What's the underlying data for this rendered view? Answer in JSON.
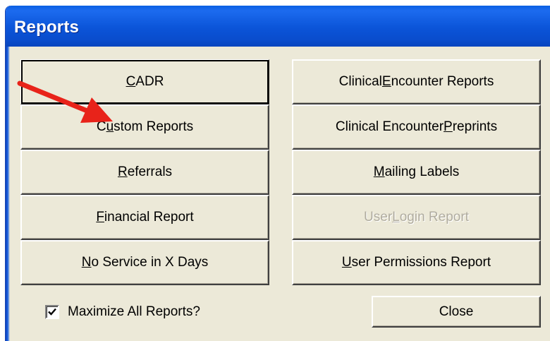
{
  "window": {
    "title": "Reports"
  },
  "buttons_left": [
    {
      "pre": "",
      "mn": "C",
      "post": "ADR",
      "enabled": true
    },
    {
      "pre": "C",
      "mn": "u",
      "post": "stom Reports",
      "enabled": true
    },
    {
      "pre": "",
      "mn": "R",
      "post": "eferrals",
      "enabled": true
    },
    {
      "pre": "",
      "mn": "F",
      "post": "inancial Report",
      "enabled": true
    },
    {
      "pre": "",
      "mn": "N",
      "post": "o Service in X Days",
      "enabled": true
    }
  ],
  "buttons_right": [
    {
      "pre": "Clinical ",
      "mn": "E",
      "post": "ncounter Reports",
      "enabled": true
    },
    {
      "pre": "Clinical Encounter ",
      "mn": "P",
      "post": "reprints",
      "enabled": true
    },
    {
      "pre": "",
      "mn": "M",
      "post": "ailing Labels",
      "enabled": true
    },
    {
      "pre": "User ",
      "mn": "L",
      "post": "ogin Report",
      "enabled": false
    },
    {
      "pre": "",
      "mn": "U",
      "post": "ser Permissions Report",
      "enabled": true
    }
  ],
  "maximize": {
    "label": "Maximize All Reports?",
    "checked": true
  },
  "close_label": "Close",
  "annotation": {
    "color": "#e8231a",
    "points_to": "Custom Reports"
  }
}
